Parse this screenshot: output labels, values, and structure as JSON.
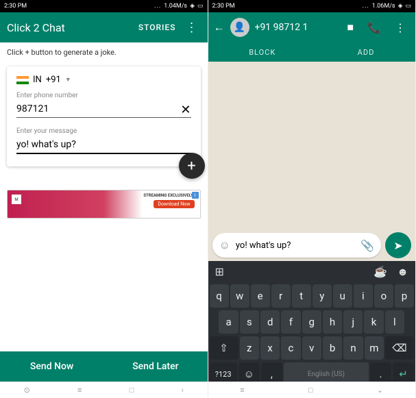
{
  "status": {
    "time": "2:30 PM",
    "speed_left": "1.04M/s",
    "speed_right": "1.06M/s"
  },
  "left": {
    "app_title": "Click 2 Chat",
    "stories": "STORIES",
    "hint": "Click + button to generate a joke.",
    "country": "IN",
    "code": "+91",
    "phone_placeholder": "Enter phone number",
    "phone_value": "987121",
    "msg_label": "Enter your message",
    "msg_value": "yo! what's up?",
    "ad_stream": "STREAMING EXCLUSIVELY!",
    "ad_download": "Download Now",
    "send_now": "Send Now",
    "send_later": "Send Later"
  },
  "right": {
    "block": "BLOCK",
    "add": "ADD",
    "contact": "+91 98712 1",
    "compose": "yo! what's up?"
  },
  "keyboard": {
    "row1": [
      "q",
      "w",
      "e",
      "r",
      "t",
      "y",
      "u",
      "i",
      "o",
      "p"
    ],
    "row2": [
      "a",
      "s",
      "d",
      "f",
      "g",
      "h",
      "j",
      "k",
      "l"
    ],
    "row3": [
      "z",
      "x",
      "c",
      "v",
      "b",
      "n",
      "m"
    ],
    "sym": "?123",
    "lang": "English (US)"
  }
}
